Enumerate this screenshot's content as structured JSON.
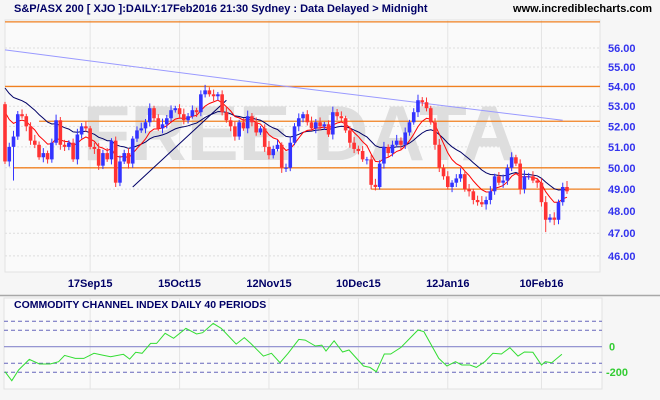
{
  "header": {
    "title": "S&P/ASX 200 [ XJO ]:DAILY:17Feb2016 21:30 Sydney : Data Delayed > Midnight",
    "site": "www.incrediblecharts.com"
  },
  "watermark": "FREE DATA",
  "colors": {
    "up": "#3333ff",
    "down": "#ff3333",
    "ma_short": "#ff0000",
    "ma_mid": "#000066",
    "ma_long": "#9999ff",
    "resistance": "#f08020",
    "cci": "#33dd33",
    "cci_ref": "#6666bb"
  },
  "chart_data": [
    {
      "type": "candlestick",
      "title": "S&P/ASX 200 [ XJO ] DAILY",
      "ylim": [
        46,
        56
      ],
      "yscale": "log",
      "y_ticks": [
        "56.00",
        "55.00",
        "54.00",
        "53.00",
        "52.00",
        "51.00",
        "50.00",
        "49.00",
        "48.00",
        "47.00",
        "46.00"
      ],
      "x_ticks": [
        {
          "label": "17Sep15",
          "day": 20
        },
        {
          "label": "15Oct15",
          "day": 41
        },
        {
          "label": "12Nov15",
          "day": 62
        },
        {
          "label": "10Dec15",
          "day": 83
        },
        {
          "label": "12Jan16",
          "day": 104
        },
        {
          "label": "10Feb16",
          "day": 126
        }
      ],
      "first_open": 53.1,
      "closes": [
        50.3,
        51.0,
        51.5,
        52.6,
        52.5,
        52.0,
        51.3,
        51.1,
        50.5,
        50.7,
        50.4,
        51.2,
        52.3,
        51.1,
        51.0,
        51.2,
        50.4,
        51.6,
        52.0,
        51.9,
        51.0,
        50.9,
        50.1,
        50.7,
        50.4,
        51.3,
        49.3,
        50.3,
        50.7,
        50.2,
        51.4,
        51.8,
        51.9,
        52.2,
        52.9,
        52.4,
        51.9,
        52.1,
        52.4,
        52.8,
        52.9,
        52.6,
        52.3,
        52.5,
        52.8,
        52.7,
        53.6,
        53.8,
        53.6,
        53.5,
        53.6,
        52.7,
        52.3,
        52.0,
        51.5,
        52.2,
        51.9,
        52.5,
        52.2,
        51.7,
        51.9,
        51.0,
        50.6,
        50.9,
        51.1,
        50.0,
        50.0,
        51.2,
        52.0,
        52.4,
        52.6,
        52.2,
        51.9,
        52.2,
        52.0,
        52.1,
        51.6,
        52.7,
        52.5,
        52.4,
        51.8,
        51.2,
        50.9,
        50.8,
        50.4,
        50.4,
        49.2,
        49.1,
        50.2,
        51.0,
        50.7,
        51.1,
        51.3,
        51.1,
        51.7,
        52.2,
        52.7,
        53.3,
        53.2,
        52.9,
        52.2,
        51.1,
        50.0,
        49.6,
        49.1,
        49.3,
        49.5,
        49.7,
        49.0,
        48.9,
        48.5,
        48.4,
        48.3,
        48.5,
        48.9,
        49.6,
        49.3,
        49.4,
        50.0,
        50.5,
        50.2,
        49.0,
        49.6,
        49.6,
        49.4,
        49.3,
        48.4,
        47.6,
        47.7,
        47.6,
        48.4,
        49.1,
        48.9
      ],
      "low_extremes": [
        {
          "day": 2,
          "low": 49.4
        },
        {
          "day": 127,
          "low": 47.05
        }
      ],
      "ma_short": {
        "period": 8,
        "seed": 53.4
      },
      "ma_mid": {
        "period": 20,
        "seed": 54.3
      },
      "ma_long_points": [
        [
          0,
          55.9
        ],
        [
          66,
          54.0
        ],
        [
          131,
          52.3
        ]
      ],
      "trendline": [
        [
          30,
          49.1
        ],
        [
          52,
          53.3
        ]
      ],
      "resistance_levels": [
        {
          "price": 57.4,
          "from_day": 0
        },
        {
          "price": 54.0,
          "from_day": 0
        },
        {
          "price": 52.25,
          "from_day": 8
        },
        {
          "price": 50.0,
          "from_day": 2
        },
        {
          "price": 49.0,
          "from_day": 86
        }
      ]
    },
    {
      "type": "line",
      "title": "COMMODITY CHANNEL INDEX DAILY 40 PERIODS",
      "y_ticks": [
        {
          "label": "0",
          "value": 0
        },
        {
          "label": "-200",
          "value": -200
        }
      ],
      "ref_lines": [
        200,
        100,
        -100,
        -200
      ],
      "zero_line": 0,
      "series": [
        [
          0,
          -194
        ],
        [
          1.6,
          -294
        ],
        [
          3.2,
          -176
        ],
        [
          5.7,
          -77
        ],
        [
          8.1,
          -109
        ],
        [
          10.6,
          -109
        ],
        [
          12.6,
          -91
        ],
        [
          14,
          -53
        ],
        [
          16.5,
          -71
        ],
        [
          18.5,
          -71
        ],
        [
          20.9,
          -40
        ],
        [
          22.9,
          -51
        ],
        [
          24.8,
          -61
        ],
        [
          27.8,
          -46
        ],
        [
          29.3,
          -75
        ],
        [
          30.7,
          -34
        ],
        [
          32.2,
          -40
        ],
        [
          34.2,
          20
        ],
        [
          35.6,
          20
        ],
        [
          37.6,
          81
        ],
        [
          39.6,
          51
        ],
        [
          42.5,
          120
        ],
        [
          45,
          77
        ],
        [
          46.4,
          85
        ],
        [
          48.9,
          176
        ],
        [
          50.8,
          120
        ],
        [
          54.3,
          16
        ],
        [
          56.2,
          55
        ],
        [
          57.7,
          20
        ],
        [
          60.7,
          -57
        ],
        [
          62.6,
          -40
        ],
        [
          64.6,
          -97
        ],
        [
          66.5,
          -40
        ],
        [
          69,
          44
        ],
        [
          70.5,
          40
        ],
        [
          72.9,
          4
        ],
        [
          74.4,
          10
        ],
        [
          75.4,
          -26
        ],
        [
          77.3,
          36
        ],
        [
          79.3,
          -32
        ],
        [
          80.8,
          -20
        ],
        [
          84.2,
          -131
        ],
        [
          85.7,
          -147
        ],
        [
          87.2,
          -194
        ],
        [
          89.1,
          -44
        ],
        [
          90.6,
          -44
        ],
        [
          93,
          -4
        ],
        [
          97,
          102
        ],
        [
          98.4,
          91
        ],
        [
          101.9,
          -71
        ],
        [
          103.8,
          -131
        ],
        [
          105.8,
          -91
        ],
        [
          107.3,
          -120
        ],
        [
          109.2,
          -120
        ],
        [
          110.7,
          -147
        ],
        [
          112.7,
          -91
        ],
        [
          114.6,
          -40
        ],
        [
          116.6,
          -44
        ],
        [
          118.6,
          -6
        ],
        [
          120.5,
          -57
        ],
        [
          122,
          -32
        ],
        [
          124,
          -34
        ],
        [
          126,
          -120
        ],
        [
          126.9,
          -91
        ],
        [
          128.4,
          -97
        ],
        [
          130.8,
          -46
        ]
      ]
    }
  ]
}
